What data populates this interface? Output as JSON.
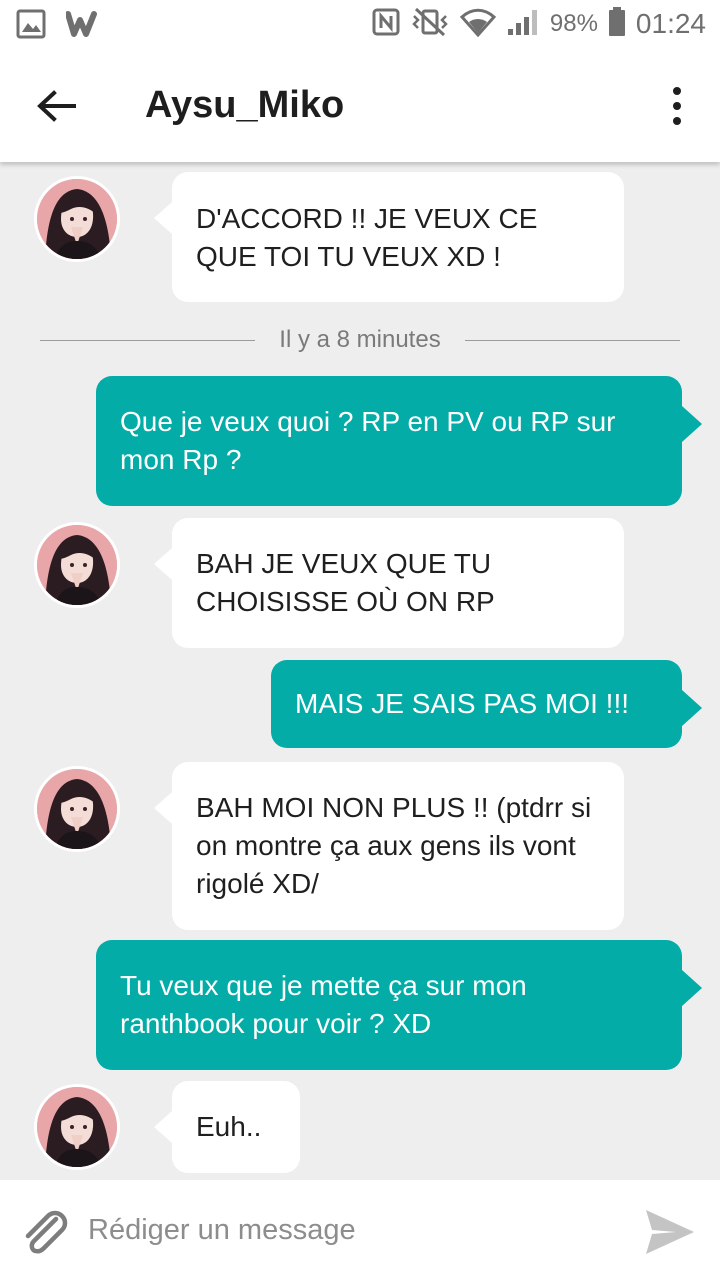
{
  "status_bar": {
    "battery_percent": "98%",
    "time": "01:24",
    "icons": [
      "gallery-icon",
      "wattpad-icon",
      "nfc-icon",
      "vibrate-icon",
      "wifi-icon",
      "signal-icon",
      "battery-icon"
    ]
  },
  "header": {
    "title": "Aysu_Miko",
    "back_icon": "arrow-left-icon",
    "menu_icon": "more-vert-icon"
  },
  "conversation": {
    "time_divider": "Il y a 8 minutes",
    "messages": [
      {
        "from": "them",
        "text": "D'ACCORD !! JE VEUX CE QUE TOI TU VEUX XD !"
      },
      {
        "from": "me",
        "text": "Que je veux quoi ? RP en PV ou RP sur mon Rp ?"
      },
      {
        "from": "them",
        "text": "BAH JE VEUX QUE TU CHOISISSE OÙ ON RP"
      },
      {
        "from": "me",
        "text": "MAIS JE SAIS PAS MOI !!!"
      },
      {
        "from": "them",
        "text": "BAH MOI NON PLUS !! (ptdrr si on montre ça aux gens ils vont rigolé XD/"
      },
      {
        "from": "me",
        "text": "Tu veux que je mette ça sur mon ranthbook pour voir ? XD"
      },
      {
        "from": "them",
        "text": "Euh.."
      }
    ]
  },
  "composer": {
    "placeholder": "Rédiger un message",
    "attach_icon": "paperclip-icon",
    "send_icon": "send-icon"
  },
  "colors": {
    "outgoing_bubble": "#03aca7",
    "incoming_bubble": "#ffffff",
    "chat_background": "#eeeeee"
  }
}
